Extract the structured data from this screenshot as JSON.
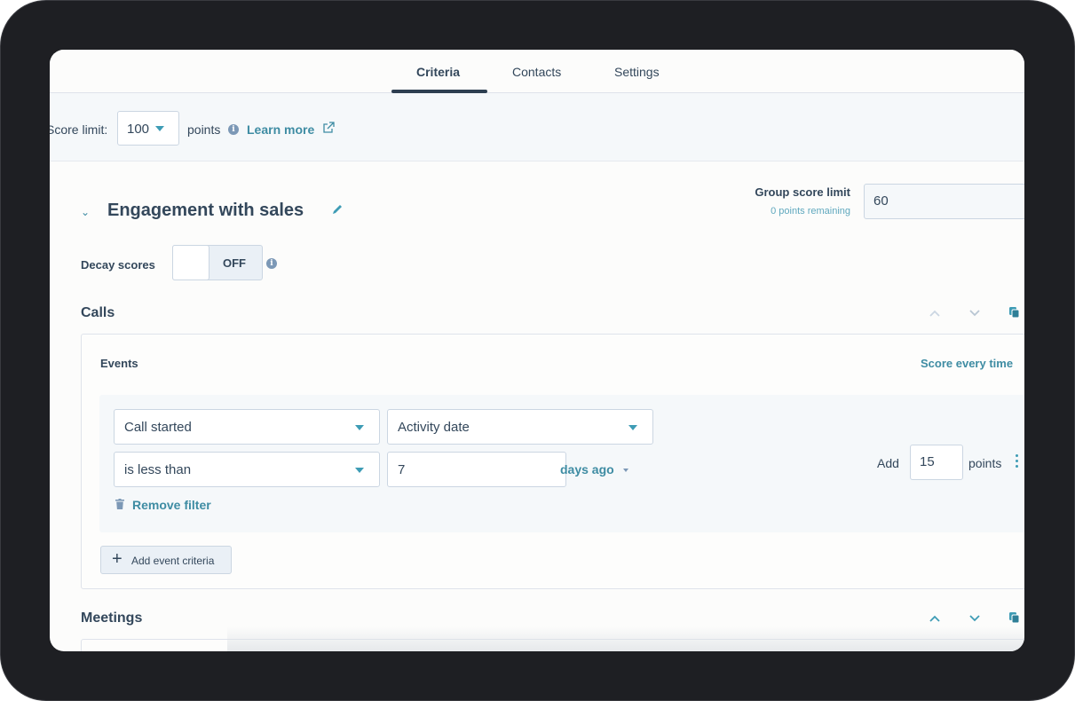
{
  "tabs": [
    {
      "label": "Criteria",
      "active": true
    },
    {
      "label": "Contacts",
      "active": false
    },
    {
      "label": "Settings",
      "active": false
    }
  ],
  "score_bar": {
    "label": "Score limit:",
    "value": "100",
    "unit": "points",
    "learn_more": "Learn more"
  },
  "group": {
    "title": "Engagement with sales",
    "score_limit_label": "Group score limit",
    "score_limit_sub": "0 points remaining",
    "score_limit_value": "60",
    "decay_label": "Decay scores",
    "decay_toggle": "OFF"
  },
  "sections": [
    {
      "title": "Calls",
      "events_label": "Events",
      "frequency": "Score every time",
      "filter": {
        "event": "Call started",
        "property": "Activity date",
        "operator": "is less than",
        "value": "7",
        "unit": "days ago",
        "remove_label": "Remove filter"
      },
      "add_label": "Add",
      "points_value": "15",
      "points_label": "points",
      "add_event_label": "Add event criteria"
    },
    {
      "title": "Meetings"
    }
  ],
  "colors": {
    "accent": "#3e8ca3",
    "text": "#33475b",
    "bezel": "#1e1f23"
  }
}
